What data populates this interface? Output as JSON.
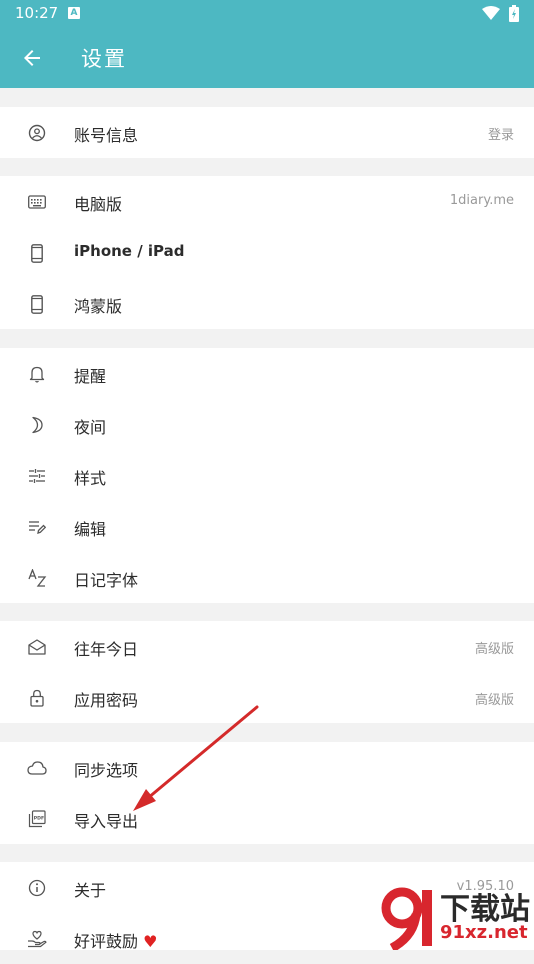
{
  "status_bar": {
    "time": "10:27",
    "notification_icon": "A"
  },
  "header": {
    "title": "设置"
  },
  "sections": [
    {
      "items": [
        {
          "icon": "account-circle-icon",
          "label": "账号信息",
          "value": "登录"
        }
      ]
    },
    {
      "items": [
        {
          "icon": "keyboard-icon",
          "label": "电脑版",
          "value": "1diary.me"
        },
        {
          "icon": "phone-icon",
          "label": "iPhone / iPad",
          "value": ""
        },
        {
          "icon": "phone-icon",
          "label": "鸿蒙版",
          "value": ""
        }
      ]
    },
    {
      "items": [
        {
          "icon": "bell-icon",
          "label": "提醒",
          "value": ""
        },
        {
          "icon": "moon-icon",
          "label": "夜间",
          "value": ""
        },
        {
          "icon": "sliders-icon",
          "label": "样式",
          "value": ""
        },
        {
          "icon": "edit-lines-icon",
          "label": "编辑",
          "value": ""
        },
        {
          "icon": "font-az-icon",
          "label": "日记字体",
          "value": ""
        }
      ]
    },
    {
      "items": [
        {
          "icon": "mail-open-icon",
          "label": "往年今日",
          "value": "高级版"
        },
        {
          "icon": "lock-icon",
          "label": "应用密码",
          "value": "高级版"
        }
      ]
    },
    {
      "items": [
        {
          "icon": "cloud-icon",
          "label": "同步选项",
          "value": ""
        },
        {
          "icon": "pdf-stack-icon",
          "label": "导入导出",
          "value": ""
        }
      ]
    },
    {
      "items": [
        {
          "icon": "info-icon",
          "label": "关于",
          "value": "v1.95.10"
        },
        {
          "icon": "hand-heart-icon",
          "label": "好评鼓励",
          "value": ""
        }
      ]
    }
  ],
  "rate_heart": "♥",
  "watermark": {
    "line1": "下载站",
    "line2": "91xz.net"
  },
  "colors": {
    "header": "#4db8c2",
    "arrow": "#d42a2a"
  }
}
